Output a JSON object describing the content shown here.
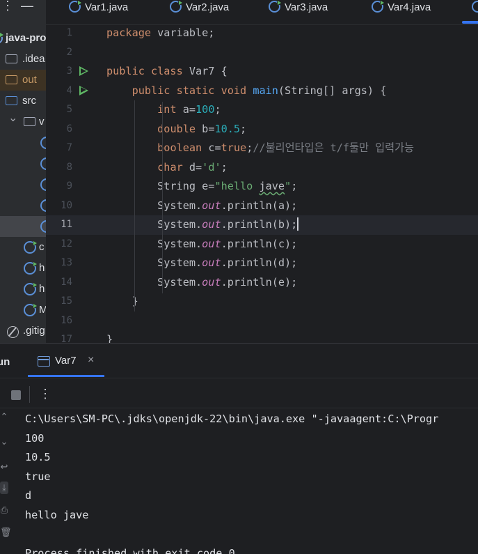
{
  "project": {
    "root_label": "java-pro",
    "items": [
      {
        "label": ".idea",
        "icon": "folder-icon"
      },
      {
        "label": "out",
        "icon": "folder-icon"
      },
      {
        "label": "src",
        "icon": "folder-icon"
      },
      {
        "label": "v",
        "icon": "package-icon"
      },
      {
        "label": "c",
        "icon": "class-icon"
      },
      {
        "label": "h",
        "icon": "class-icon"
      },
      {
        "label": "h",
        "icon": "class-icon"
      },
      {
        "label": "M",
        "icon": "class-icon"
      },
      {
        "label": ".gitig",
        "icon": "ignore-icon"
      }
    ]
  },
  "tabs": [
    {
      "label": "Var1.java",
      "icon": "class-icon"
    },
    {
      "label": "Var2.java",
      "icon": "class-icon"
    },
    {
      "label": "Var3.java",
      "icon": "class-icon"
    },
    {
      "label": "Var4.java",
      "icon": "class-icon"
    }
  ],
  "editor": {
    "current_line": 11,
    "lines": [
      {
        "n": "1",
        "tokens": [
          {
            "t": "kw",
            "v": "package"
          },
          {
            "t": "pl",
            "v": " variable;"
          }
        ]
      },
      {
        "n": "2",
        "tokens": []
      },
      {
        "n": "3",
        "run": true,
        "tokens": [
          {
            "t": "kw",
            "v": "public class"
          },
          {
            "t": "pl",
            "v": " Var7 {"
          }
        ]
      },
      {
        "n": "4",
        "run": true,
        "tokens": [
          {
            "t": "pl",
            "v": "    "
          },
          {
            "t": "kw",
            "v": "public static void"
          },
          {
            "t": "pl",
            "v": " "
          },
          {
            "t": "fn",
            "v": "main"
          },
          {
            "t": "pl",
            "v": "(String[] args) {"
          }
        ]
      },
      {
        "n": "5",
        "tokens": [
          {
            "t": "pl",
            "v": "        "
          },
          {
            "t": "kw",
            "v": "int"
          },
          {
            "t": "pl",
            "v": " a="
          },
          {
            "t": "num",
            "v": "100"
          },
          {
            "t": "pl",
            "v": ";"
          }
        ]
      },
      {
        "n": "6",
        "tokens": [
          {
            "t": "pl",
            "v": "        "
          },
          {
            "t": "kw",
            "v": "double"
          },
          {
            "t": "pl",
            "v": " b="
          },
          {
            "t": "num",
            "v": "10.5"
          },
          {
            "t": "pl",
            "v": ";"
          }
        ]
      },
      {
        "n": "7",
        "tokens": [
          {
            "t": "pl",
            "v": "        "
          },
          {
            "t": "kw",
            "v": "boolean"
          },
          {
            "t": "pl",
            "v": " c="
          },
          {
            "t": "kw",
            "v": "true"
          },
          {
            "t": "pl",
            "v": ";"
          },
          {
            "t": "cm",
            "v": "//불리언타입은 t/f둘만 입력가능"
          }
        ]
      },
      {
        "n": "8",
        "tokens": [
          {
            "t": "pl",
            "v": "        "
          },
          {
            "t": "kw",
            "v": "char"
          },
          {
            "t": "pl",
            "v": " d="
          },
          {
            "t": "str",
            "v": "'d'"
          },
          {
            "t": "pl",
            "v": ";"
          }
        ]
      },
      {
        "n": "9",
        "tokens": [
          {
            "t": "pl",
            "v": "        String e="
          },
          {
            "t": "str",
            "v": "\"hello "
          },
          {
            "t": "sq",
            "v": "jave"
          },
          {
            "t": "str",
            "v": "\""
          },
          {
            "t": "pl",
            "v": ";"
          }
        ]
      },
      {
        "n": "10",
        "tokens": [
          {
            "t": "pl",
            "v": "        System."
          },
          {
            "t": "st",
            "v": "out"
          },
          {
            "t": "pl",
            "v": ".println(a);"
          }
        ]
      },
      {
        "n": "11",
        "caret": true,
        "tokens": [
          {
            "t": "pl",
            "v": "        System."
          },
          {
            "t": "st",
            "v": "out"
          },
          {
            "t": "pl",
            "v": ".println(b);"
          }
        ]
      },
      {
        "n": "12",
        "tokens": [
          {
            "t": "pl",
            "v": "        System."
          },
          {
            "t": "st",
            "v": "out"
          },
          {
            "t": "pl",
            "v": ".println(c);"
          }
        ]
      },
      {
        "n": "13",
        "tokens": [
          {
            "t": "pl",
            "v": "        System."
          },
          {
            "t": "st",
            "v": "out"
          },
          {
            "t": "pl",
            "v": ".println(d);"
          }
        ]
      },
      {
        "n": "14",
        "tokens": [
          {
            "t": "pl",
            "v": "        System."
          },
          {
            "t": "st",
            "v": "out"
          },
          {
            "t": "pl",
            "v": ".println(e);"
          }
        ]
      },
      {
        "n": "15",
        "tokens": [
          {
            "t": "pl",
            "v": "    }"
          }
        ]
      },
      {
        "n": "16",
        "tokens": []
      },
      {
        "n": "17",
        "tokens": [
          {
            "t": "pl",
            "v": "}"
          }
        ]
      }
    ]
  },
  "run": {
    "title": "un",
    "tab_label": "Var7",
    "tab_close": "×",
    "more": "⋮",
    "output": [
      "C:\\Users\\SM-PC\\.jdks\\openjdk-22\\bin\\java.exe \"-javaagent:C:\\Progr",
      "100",
      "10.5",
      "true",
      "d",
      "hello jave",
      "",
      "Process finished with exit code 0"
    ]
  },
  "colors": {
    "keyword": "#cf8e6d",
    "number": "#2aacb8",
    "string": "#6aab73",
    "function": "#56a8f5",
    "static_field": "#c77dbb",
    "comment": "#7a7e85",
    "accent": "#3574f0"
  }
}
